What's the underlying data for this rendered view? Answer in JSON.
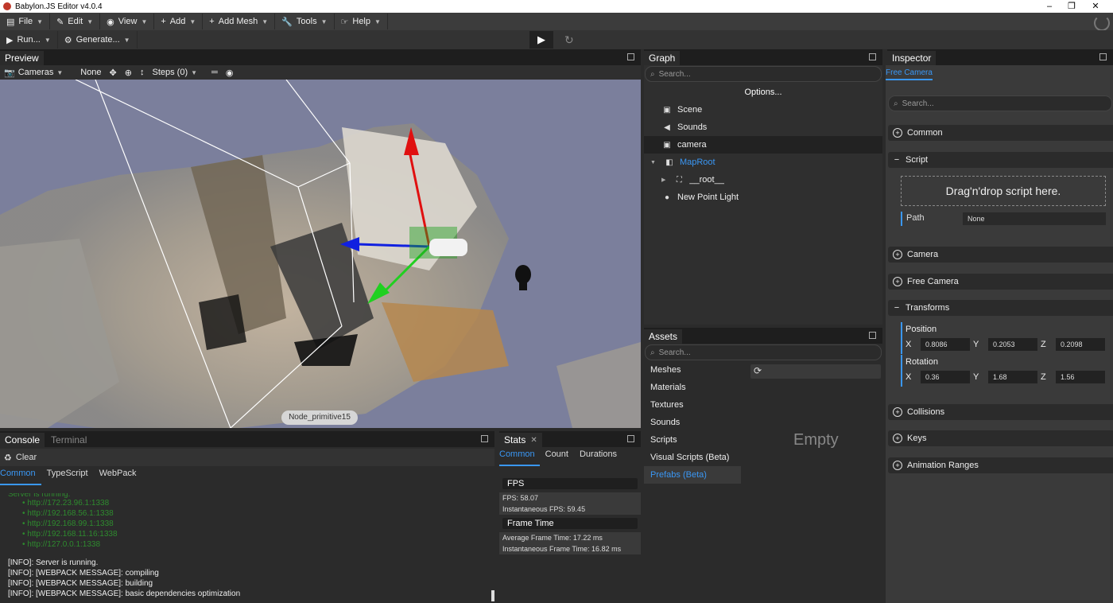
{
  "window": {
    "title": "Babylon.JS Editor v4.0.4"
  },
  "menubar": {
    "items": [
      {
        "label": "File",
        "icon": "file-icon"
      },
      {
        "label": "Edit",
        "icon": "edit-icon"
      },
      {
        "label": "View",
        "icon": "eye-icon"
      },
      {
        "label": "Add",
        "icon": "plus-icon"
      },
      {
        "label": "Add Mesh",
        "icon": "plus-icon"
      },
      {
        "label": "Tools",
        "icon": "wrench-icon"
      },
      {
        "label": "Help",
        "icon": "hand-icon"
      }
    ]
  },
  "toolbar": {
    "run_label": "Run...",
    "generate_label": "Generate..."
  },
  "preview": {
    "tab": "Preview",
    "cameras_label": "Cameras",
    "none_label": "None",
    "steps_label": "Steps (0)",
    "node_label": "Node_primitive15"
  },
  "console": {
    "tabs": [
      "Console",
      "Terminal"
    ],
    "clear_label": "Clear",
    "subtabs": [
      "Common",
      "TypeScript",
      "WebPack"
    ],
    "faded_header": "Server is running.",
    "urls": [
      "http://172.23.96.1:1338",
      "http://192.168.56.1:1338",
      "http://192.168.99.1:1338",
      "http://192.168.11.16:1338",
      "http://127.0.0.1:1338"
    ],
    "logs": [
      "[INFO]: Server is running.",
      "[INFO]: [WEBPACK MESSAGE]: compiling",
      "[INFO]: [WEBPACK MESSAGE]: building",
      "[INFO]: [WEBPACK MESSAGE]: basic dependencies optimization"
    ]
  },
  "stats": {
    "tab": "Stats",
    "subtabs": [
      "Common",
      "Count",
      "Durations"
    ],
    "fps_header": "FPS",
    "fps": "FPS: 58.07",
    "instant_fps": "Instantaneous FPS: 59.45",
    "frame_header": "Frame Time",
    "avg_frame": "Average Frame Time: 17.22 ms",
    "instant_frame": "Instantaneous Frame Time: 16.82 ms"
  },
  "graph": {
    "tab": "Graph",
    "search_placeholder": "Search...",
    "options_label": "Options...",
    "items": [
      {
        "label": "Scene"
      },
      {
        "label": "Sounds"
      },
      {
        "label": "camera"
      },
      {
        "label": "MapRoot"
      },
      {
        "label": "__root__"
      },
      {
        "label": "New Point Light"
      }
    ]
  },
  "assets": {
    "tab": "Assets",
    "search_placeholder": "Search...",
    "categories": [
      "Meshes",
      "Materials",
      "Textures",
      "Sounds",
      "Scripts",
      "Visual Scripts (Beta)",
      "Prefabs (Beta)"
    ],
    "empty_label": "Empty"
  },
  "inspector": {
    "tab": "Inspector",
    "subtab": "Free Camera",
    "search_placeholder": "Search...",
    "sections": {
      "common": "Common",
      "script": "Script",
      "camera": "Camera",
      "free_camera": "Free Camera",
      "transforms": "Transforms",
      "collisions": "Collisions",
      "keys": "Keys",
      "animation_ranges": "Animation Ranges"
    },
    "drop_text": "Drag'n'drop script here.",
    "path_label": "Path",
    "path_value": "None",
    "position_label": "Position",
    "rotation_label": "Rotation",
    "axes": [
      "X",
      "Y",
      "Z"
    ],
    "position": [
      "0.8086",
      "0.2053",
      "0.2098"
    ],
    "rotation": [
      "0.36",
      "1.68",
      "1.56"
    ]
  },
  "colors": {
    "accent": "#3a97f4",
    "viewport_bg": "#7b7f9c",
    "panel_bg": "#2b2b2b"
  }
}
